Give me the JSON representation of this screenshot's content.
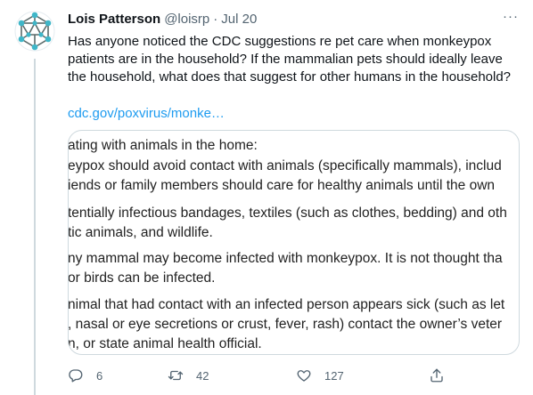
{
  "tweet": {
    "author": "Lois Patterson",
    "handle": "@loisrp",
    "separator": "·",
    "date": "Jul 20",
    "more": "···",
    "text": "Has anyone noticed the CDC suggestions re pet care when monkeypox patients are in the household? If the mammalian pets should ideally leave the household, what does that suggest for other humans in the household?",
    "link": "cdc.gov/poxvirus/monke…"
  },
  "card": {
    "lines": [
      "ating with animals in the home:",
      "eypox should avoid contact with animals (specifically mammals), includ",
      "iends or family members should care for healthy animals until the own",
      "tentially infectious bandages, textiles (such as clothes, bedding) and oth",
      "tic animals, and wildlife.",
      "ny mammal may become infected with monkeypox. It is not thought tha",
      "or birds can be infected.",
      "nimal that had contact with an infected person appears sick (such as let",
      ", nasal or eye secretions or crust, fever, rash) contact the owner’s veter",
      "n, or state animal health official."
    ]
  },
  "actions": {
    "replies": "6",
    "retweets": "42",
    "likes": "127"
  },
  "colors": {
    "link": "#1d9bf0",
    "muted": "#536471",
    "text": "#0f1419",
    "border": "#cfd9de"
  }
}
